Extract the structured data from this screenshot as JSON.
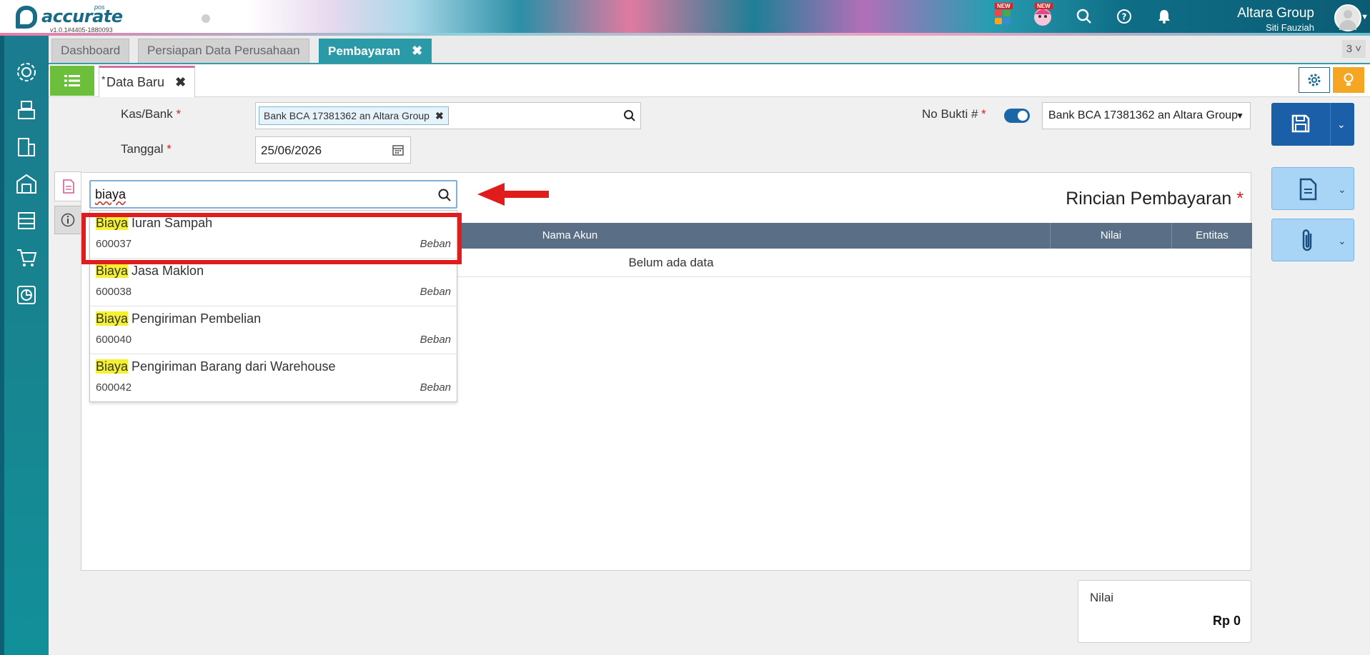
{
  "app": {
    "logo_text": "accurate",
    "logo_pos": "pos",
    "version": "v1.0.1#4405-1880093",
    "new_badge": "NEW",
    "company_name": "Altara Group",
    "user_name": "Siti Fauziah"
  },
  "tabs": [
    {
      "label": "Dashboard",
      "active": false
    },
    {
      "label": "Persiapan Data Perusahaan",
      "active": false
    },
    {
      "label": "Pembayaran",
      "active": true
    }
  ],
  "tab_count": "3",
  "subtab": {
    "asterisk": "*",
    "label": "Data Baru"
  },
  "form": {
    "kas_bank_label": "Kas/Bank",
    "kas_bank_value": "Bank BCA 17381362 an Altara Group",
    "tanggal_label": "Tanggal",
    "tanggal_value": "25/06/2026",
    "no_bukti_label": "No Bukti #",
    "no_bukti_select": "Bank BCA 17381362 an Altara Group",
    "required_mark": "*"
  },
  "panel": {
    "title": "Rincian Pembayaran",
    "columns": [
      "Nama Akun",
      "Nilai",
      "Entitas"
    ],
    "empty_text": "Belum ada data"
  },
  "search": {
    "value": "biaya",
    "highlight": "Biaya",
    "results": [
      {
        "rest": " Iuran Sampah",
        "code": "600037",
        "type": "Beban"
      },
      {
        "rest": " Jasa Maklon",
        "code": "600038",
        "type": "Beban"
      },
      {
        "rest": " Pengiriman Pembelian",
        "code": "600040",
        "type": "Beban"
      },
      {
        "rest": " Pengiriman Barang dari Warehouse",
        "code": "600042",
        "type": "Beban"
      }
    ]
  },
  "summary": {
    "label": "Nilai",
    "value": "Rp 0"
  },
  "colors": {
    "accent": "#2a9aa8",
    "primary": "#1a5fa8",
    "highlight": "#e01c1c",
    "list_btn": "#6bbf3a",
    "bulb": "#f5a623"
  }
}
